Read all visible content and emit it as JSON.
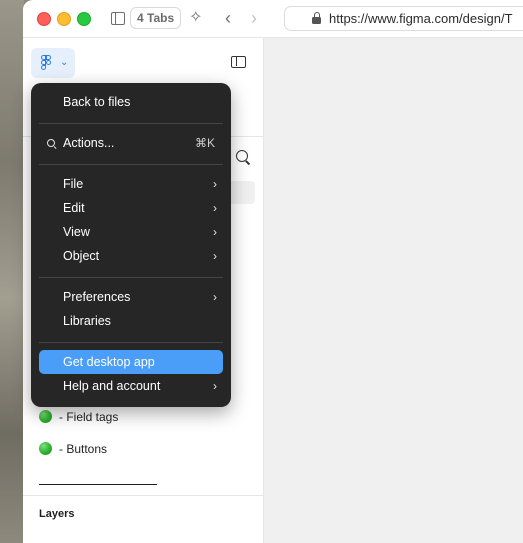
{
  "browser": {
    "tabs_label": "4 Tabs",
    "url": "https://www.figma.com/design/T"
  },
  "menu": {
    "back_to_files": "Back to files",
    "actions": {
      "label": "Actions...",
      "shortcut": "⌘K"
    },
    "file": "File",
    "edit": "Edit",
    "view": "View",
    "object": "Object",
    "preferences": "Preferences",
    "libraries": "Libraries",
    "get_desktop_app": "Get desktop app",
    "help_and_account": "Help and account",
    "submenu_arrow": "›",
    "highlight_color": "#4a9ef7"
  },
  "pages": [
    {
      "label": "- Field tags",
      "status_color": "#2fb12f"
    },
    {
      "label": "- Buttons",
      "status_color": "#2fb12f"
    }
  ],
  "layers": {
    "heading": "Layers"
  },
  "icons": {
    "sparkle": "✧",
    "back": "‹",
    "forward": "›",
    "chevron_down": "⌄"
  }
}
